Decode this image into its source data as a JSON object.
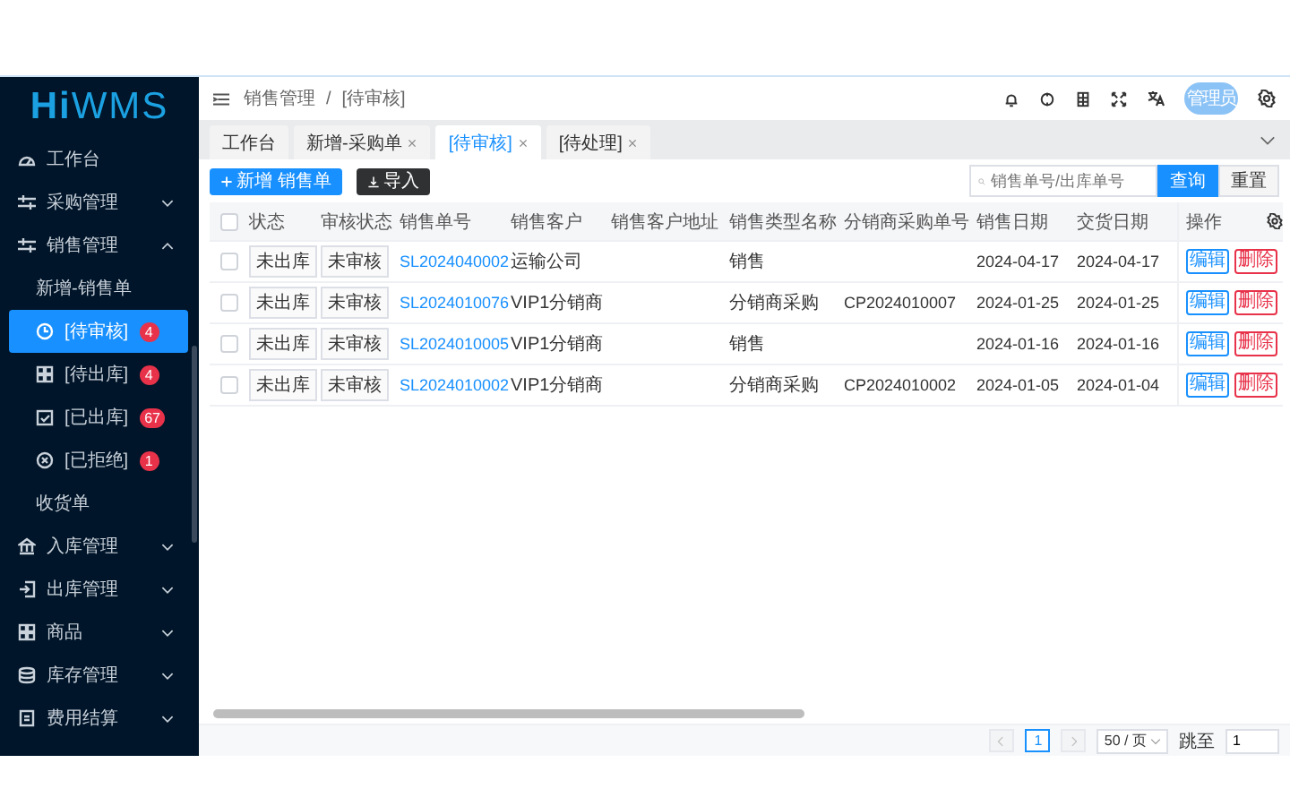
{
  "logo": "HiWMS",
  "sidebar": {
    "items": [
      {
        "label": "工作台",
        "selected": false
      },
      {
        "label": "采购管理",
        "selected": false,
        "expanded": false
      },
      {
        "label": "销售管理",
        "selected": false,
        "expanded": true,
        "children": [
          {
            "label": "新增-销售单",
            "selected": false
          },
          {
            "label": "[待审核]",
            "badge": "4",
            "selected": true
          },
          {
            "label": "[待出库]",
            "badge": "4",
            "selected": false
          },
          {
            "label": "[已出库]",
            "badge": "67",
            "selected": false
          },
          {
            "label": "[已拒绝]",
            "badge": "1",
            "selected": false
          },
          {
            "label": "收货单",
            "selected": false
          }
        ]
      },
      {
        "label": "入库管理",
        "selected": false,
        "expanded": false
      },
      {
        "label": "出库管理",
        "selected": false,
        "expanded": false
      },
      {
        "label": "商品",
        "selected": false,
        "expanded": false
      },
      {
        "label": "库存管理",
        "selected": false,
        "expanded": false
      },
      {
        "label": "费用结算",
        "selected": false,
        "expanded": false
      }
    ]
  },
  "header": {
    "breadcrumb": [
      "销售管理",
      "[待审核]"
    ],
    "breadcrumb_separator": "/",
    "avatar": "管理员"
  },
  "tabs": [
    {
      "label": "工作台",
      "closable": false,
      "selected": false
    },
    {
      "label": "新增-采购单",
      "closable": true,
      "selected": false
    },
    {
      "label": "[待审核]",
      "closable": true,
      "selected": true
    },
    {
      "label": "[待处理]",
      "closable": true,
      "selected": false
    }
  ],
  "toolbar": {
    "add_button": "新增 销售单",
    "import_button": "导入",
    "search": {
      "placeholder": "销售单号/出库单号"
    },
    "query_button": "查询",
    "reset_button": "重置"
  },
  "table": {
    "columns": [
      "状态",
      "审核状态",
      "销售单号",
      "销售客户",
      "销售客户地址",
      "销售类型名称",
      "分销商采购单号",
      "销售日期",
      "交货日期",
      "操作"
    ],
    "header_checked": false,
    "rows": [
      {
        "checked": false,
        "cells": [
          "未出库",
          "未审核",
          "SL2024040002",
          "运输公司",
          "",
          "销售",
          "",
          "2024-04-17",
          "2024-04-17"
        ],
        "actions": [
          "编辑",
          "删除"
        ]
      },
      {
        "checked": false,
        "cells": [
          "未出库",
          "未审核",
          "SL2024010076",
          "VIP1分销商",
          "",
          "分销商采购",
          "CP2024010007",
          "2024-01-25",
          "2024-01-25"
        ],
        "actions": [
          "编辑",
          "删除"
        ]
      },
      {
        "checked": false,
        "cells": [
          "未出库",
          "未审核",
          "SL2024010005",
          "VIP1分销商",
          "",
          "销售",
          "",
          "2024-01-16",
          "2024-01-16"
        ],
        "actions": [
          "编辑",
          "删除"
        ]
      },
      {
        "checked": false,
        "cells": [
          "未出库",
          "未审核",
          "SL2024010002",
          "VIP1分销商",
          "",
          "分销商采购",
          "CP2024010002",
          "2024-01-05",
          "2024-01-04"
        ],
        "actions": [
          "编辑",
          "删除"
        ]
      }
    ]
  },
  "pagination": {
    "prev_disabled": true,
    "pages": [
      {
        "label": "1",
        "selected": true
      }
    ],
    "next_disabled": true,
    "page_size": "50 / 页",
    "jump_label": "跳至",
    "jump_value": "1"
  }
}
